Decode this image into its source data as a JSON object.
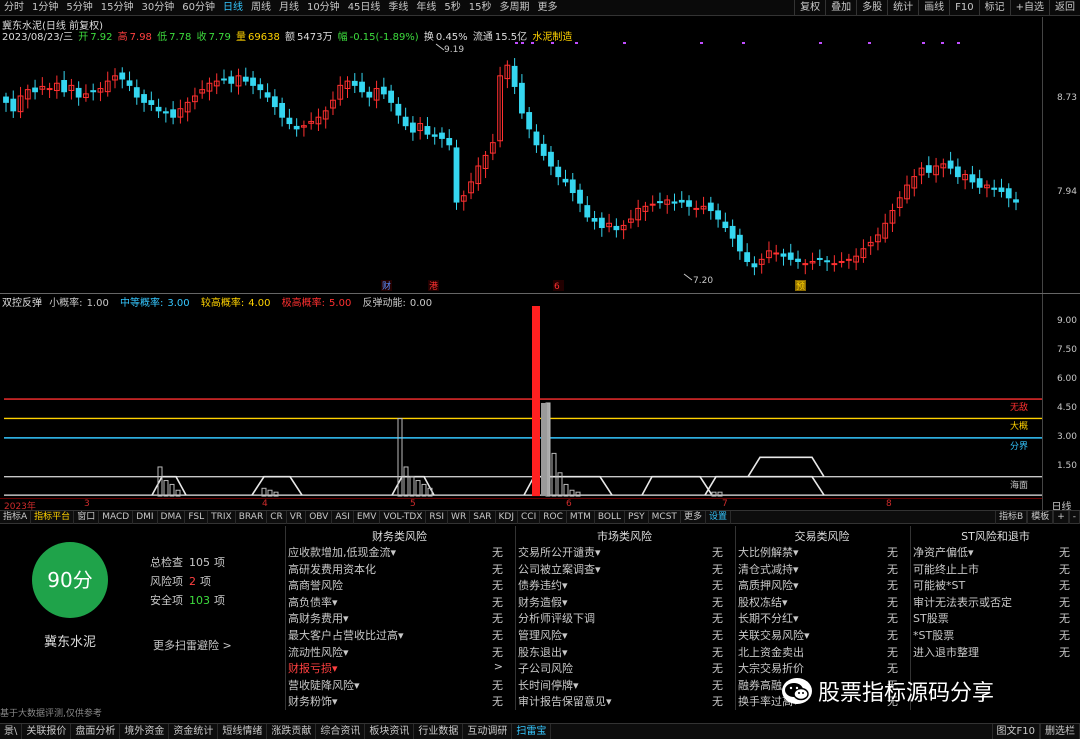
{
  "toolbar": {
    "title": "冀东水泥(日线 前复权)",
    "periods": [
      "分时",
      "1分钟",
      "5分钟",
      "15分钟",
      "30分钟",
      "60分钟",
      "日线",
      "周线",
      "月线",
      "10分钟",
      "45日线",
      "季线",
      "年线",
      "5秒",
      "15秒",
      "多周期",
      "更多"
    ],
    "active_period": "日线",
    "right_buttons": [
      "复权",
      "叠加",
      "多股",
      "统计",
      "画线",
      "F10",
      "标记",
      "+自选",
      "返回"
    ]
  },
  "quote": {
    "date": "2023/08/23/三",
    "open_label": "开",
    "open": "7.92",
    "high_label": "高",
    "high": "7.98",
    "low_label": "低",
    "low": "7.78",
    "close_label": "收",
    "close": "7.79",
    "volume_label": "量",
    "volume": "69638",
    "amount_label": "额",
    "amount": "5473万",
    "change_label": "幅",
    "change": "-0.15(-1.89%)",
    "turnover_label": "换",
    "turnover": "0.45%",
    "float_label": "流通",
    "float": "15.5亿",
    "sector": "水泥制造"
  },
  "main_axis": {
    "labels": [
      "8.73",
      "7.94"
    ],
    "colors": {
      "up": "#ff3030",
      "down": "#35d6f0"
    }
  },
  "main_annotations": {
    "high_mark": "9.19",
    "low_mark": "7.20",
    "events": [
      "财",
      "港",
      "6",
      "预"
    ]
  },
  "indicator": {
    "name": "双控反弹",
    "params": [
      {
        "label": "小概率:",
        "value": "1.00",
        "color": "#c8c8c8"
      },
      {
        "label": "中等概率:",
        "value": "3.00",
        "color": "#35c7ff"
      },
      {
        "label": "较高概率:",
        "value": "4.00",
        "color": "#ffd200"
      },
      {
        "label": "极高概率:",
        "value": "5.00",
        "color": "#ff3030"
      },
      {
        "label": "反弹动能:",
        "value": "0.00",
        "color": "#c8c8c8"
      }
    ],
    "axis_labels": [
      "9.00",
      "7.50",
      "6.00",
      "4.50",
      "3.00",
      "1.50"
    ],
    "line_labels": [
      "无敌",
      "大概",
      "分界",
      "海面"
    ],
    "line_colors": [
      "#ff3030",
      "#ffd200",
      "#35c7ff",
      "#c8c8c8"
    ]
  },
  "date_axis": {
    "labels": [
      "2023年",
      "3",
      "4",
      "5",
      "6",
      "7",
      "8"
    ],
    "right_label": "日线"
  },
  "indicator_tabs": {
    "items": [
      "指标A",
      "指标平台",
      "窗口",
      "MACD",
      "DMI",
      "DMA",
      "FSL",
      "TRIX",
      "BRAR",
      "CR",
      "VR",
      "OBV",
      "ASI",
      "EMV",
      "VOL-TDX",
      "RSI",
      "WR",
      "SAR",
      "KDJ",
      "CCI",
      "ROC",
      "MTM",
      "BOLL",
      "PSY",
      "MCST",
      "更多",
      "设置"
    ],
    "right": [
      "指标B",
      "模板",
      "+",
      "-"
    ]
  },
  "risk": {
    "score": "90分",
    "stock_name": "冀东水泥",
    "total_label": "总检查",
    "total": "105",
    "total_unit": "项",
    "risk_label": "风险项",
    "risk_count": "2",
    "risk_unit": "项",
    "safe_label": "安全项",
    "safe_count": "103",
    "safe_unit": "项",
    "more_scan": "更多扫雷避险 >",
    "footnote": "基于大数据评测,仅供参考",
    "columns": [
      {
        "title": "财务类风险",
        "rows": [
          {
            "label": "应收款增加,低现金流▾",
            "status": "无"
          },
          {
            "label": "高研发费用资本化",
            "status": "无"
          },
          {
            "label": "高商誉风险",
            "status": "无"
          },
          {
            "label": "高负债率▾",
            "status": "无"
          },
          {
            "label": "高财务费用▾",
            "status": "无"
          },
          {
            "label": "最大客户占营收比过高▾",
            "status": "无"
          },
          {
            "label": "流动性风险▾",
            "status": "无"
          },
          {
            "label": "财报亏损▾",
            "status": ">",
            "alert": true
          },
          {
            "label": "营收陡降风险▾",
            "status": "无"
          },
          {
            "label": "财务粉饰▾",
            "status": "无"
          }
        ]
      },
      {
        "title": "市场类风险",
        "rows": [
          {
            "label": "交易所公开谴责▾",
            "status": "无"
          },
          {
            "label": "公司被立案调查▾",
            "status": "无"
          },
          {
            "label": "债券违约▾",
            "status": "无"
          },
          {
            "label": "财务造假▾",
            "status": "无"
          },
          {
            "label": "分析师评级下调",
            "status": "无"
          },
          {
            "label": "管理风险▾",
            "status": "无"
          },
          {
            "label": "股东退出▾",
            "status": "无"
          },
          {
            "label": "子公司风险",
            "status": "无"
          },
          {
            "label": "长时间停牌▾",
            "status": "无"
          },
          {
            "label": "审计报告保留意见▾",
            "status": "无"
          }
        ]
      },
      {
        "title": "交易类风险",
        "rows": [
          {
            "label": "大比例解禁▾",
            "status": "无"
          },
          {
            "label": "清仓式减持▾",
            "status": "无"
          },
          {
            "label": "高质押风险▾",
            "status": "无"
          },
          {
            "label": "股权冻结▾",
            "status": "无"
          },
          {
            "label": "长期不分红▾",
            "status": "无"
          },
          {
            "label": "关联交易风险▾",
            "status": "无"
          },
          {
            "label": "北上资金卖出",
            "status": "无"
          },
          {
            "label": "大宗交易折价",
            "status": "无"
          },
          {
            "label": "融券高融",
            "status": "无"
          },
          {
            "label": "换手率过高▾",
            "status": "无"
          }
        ]
      },
      {
        "title": "ST风险和退市",
        "rows": [
          {
            "label": "净资产偏低▾",
            "status": "无"
          },
          {
            "label": "可能终止上市",
            "status": "无"
          },
          {
            "label": "可能被*ST",
            "status": "无"
          },
          {
            "label": "审计无法表示或否定",
            "status": "无"
          },
          {
            "label": "ST股票",
            "status": "无"
          },
          {
            "label": "*ST股票",
            "status": "无"
          },
          {
            "label": "进入退市整理",
            "status": "无"
          }
        ]
      }
    ]
  },
  "watermark": "股票指标源码分享",
  "bottom_tabs": {
    "items": [
      "景\\",
      "关联报价",
      "盘面分析",
      "境外资金",
      "资金统计",
      "短线情绪",
      "涨跌贡献",
      "综合资讯",
      "板块资讯",
      "行业数据",
      "互动调研",
      "扫雷宝"
    ],
    "active": "扫雷宝",
    "right": [
      "图文F10",
      "删选栏"
    ]
  }
}
